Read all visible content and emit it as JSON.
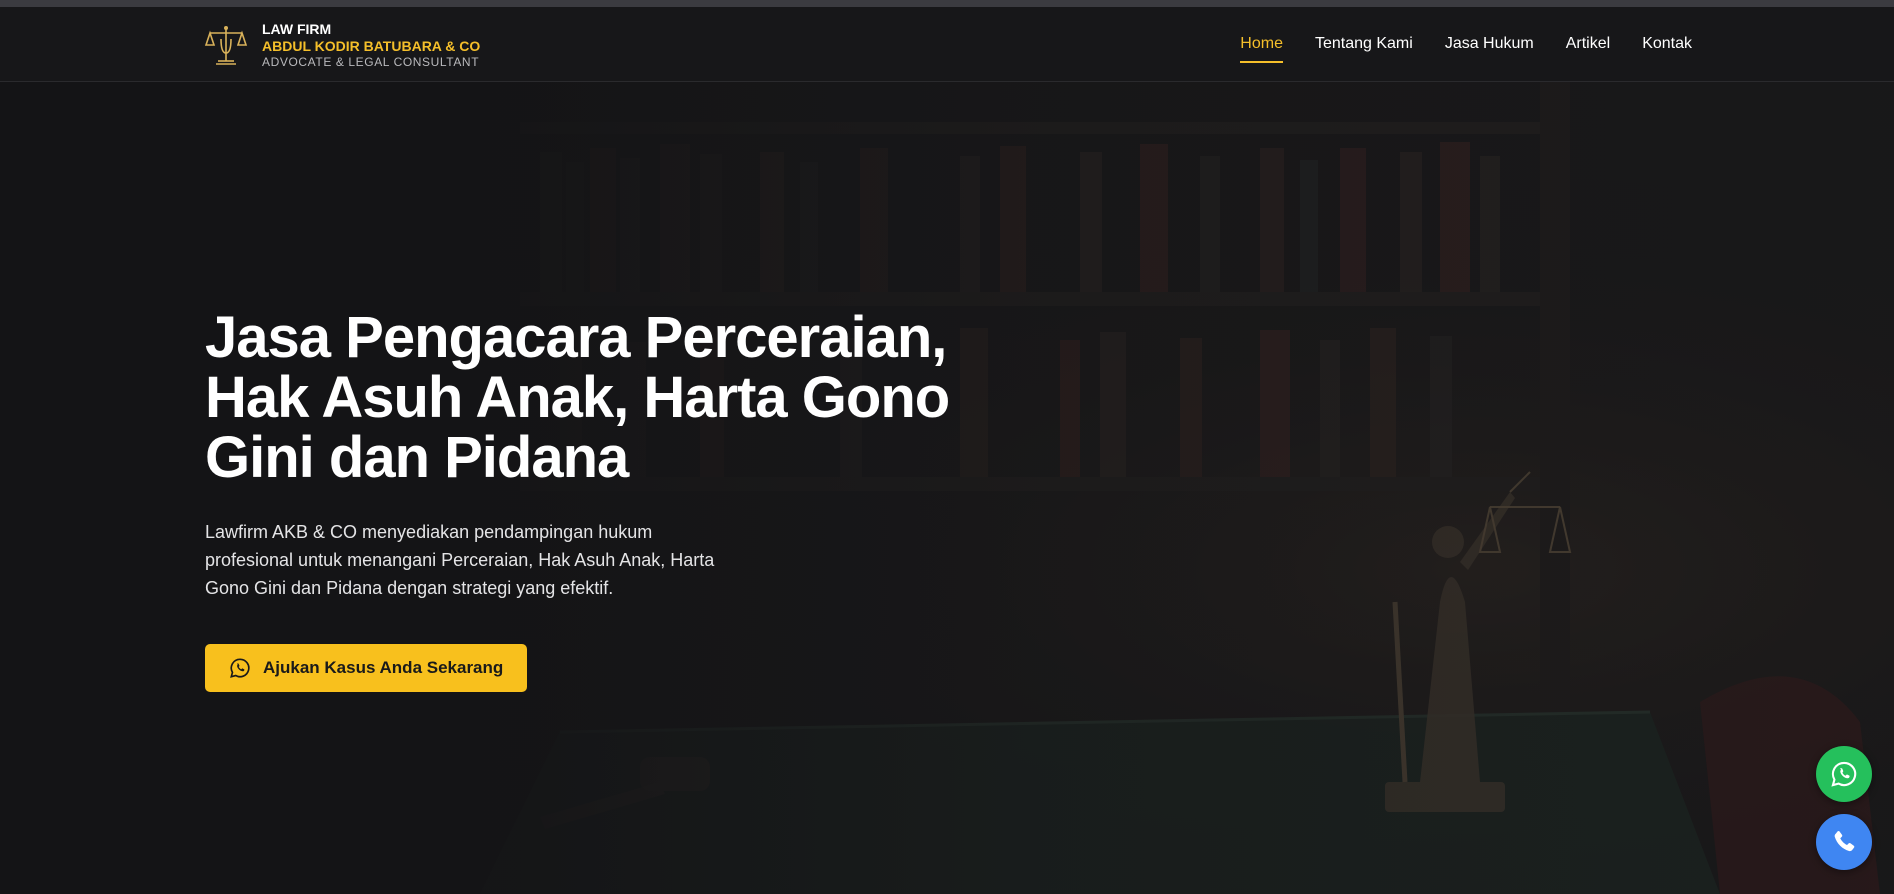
{
  "brand": {
    "line1": "LAW FIRM",
    "line2": "ABDUL KODIR BATUBARA & CO",
    "line3": "ADVOCATE & LEGAL CONSULTANT",
    "logo_icon": "scales-of-justice-logo"
  },
  "nav": {
    "items": [
      {
        "label": "Home",
        "active": true
      },
      {
        "label": "Tentang Kami",
        "active": false
      },
      {
        "label": "Jasa Hukum",
        "active": false
      },
      {
        "label": "Artikel",
        "active": false
      },
      {
        "label": "Kontak",
        "active": false
      }
    ]
  },
  "hero": {
    "title": "Jasa Pengacara Perceraian, Hak Asuh Anak, Harta Gono Gini dan Pidana",
    "description": "Lawfirm AKB & CO menyediakan pendampingan hukum profesional untuk menangani Perceraian, Hak Asuh Anak, Harta Gono Gini dan Pidana dengan strategi yang efektif.",
    "cta_label": "Ajukan Kasus Anda Sekarang",
    "cta_icon": "whatsapp-icon"
  },
  "floating": {
    "whatsapp_icon": "whatsapp-icon",
    "phone_icon": "phone-icon"
  },
  "colors": {
    "accent": "#f5bf2a",
    "cta_bg": "#f8c01d",
    "navbar_bg": "#171719",
    "whatsapp": "#25c05c",
    "phone": "#3f86f2"
  }
}
